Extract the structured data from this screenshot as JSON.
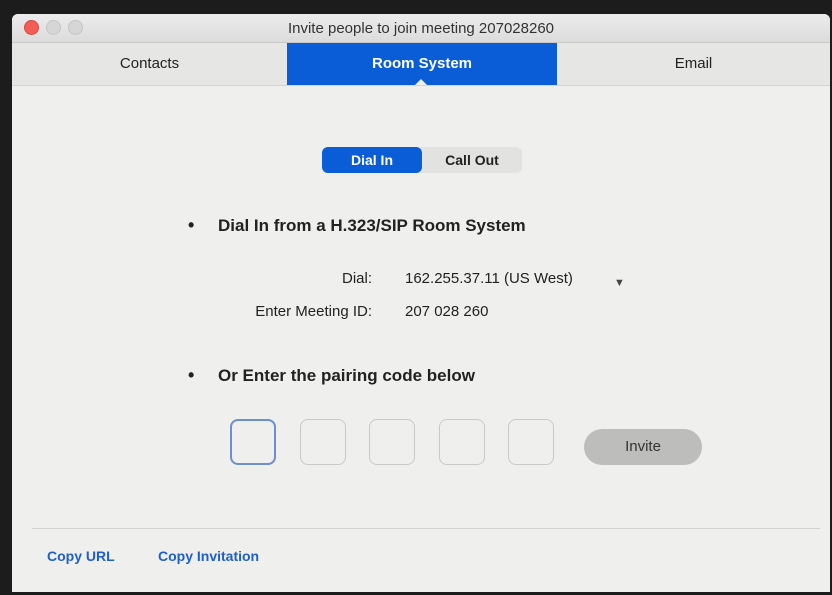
{
  "window": {
    "title": "Invite people to join meeting 207028260"
  },
  "tabs": [
    {
      "label": "Contacts"
    },
    {
      "label": "Room System"
    },
    {
      "label": "Email"
    }
  ],
  "segment": {
    "dial_in": "Dial In",
    "call_out": "Call Out"
  },
  "dial_in_section": {
    "heading": "Dial In from a H.323/SIP Room System",
    "dial_label": "Dial:",
    "dial_value": "162.255.37.11 (US West)",
    "meeting_id_label": "Enter Meeting ID:",
    "meeting_id_value": "207 028 260"
  },
  "pairing_section": {
    "heading": "Or Enter the pairing code below",
    "invite_label": "Invite"
  },
  "footer": {
    "copy_url": "Copy URL",
    "copy_invitation": "Copy Invitation"
  },
  "colors": {
    "accent": "#0b5cd7",
    "link": "#1f5fc9",
    "close": "#f25d55"
  }
}
